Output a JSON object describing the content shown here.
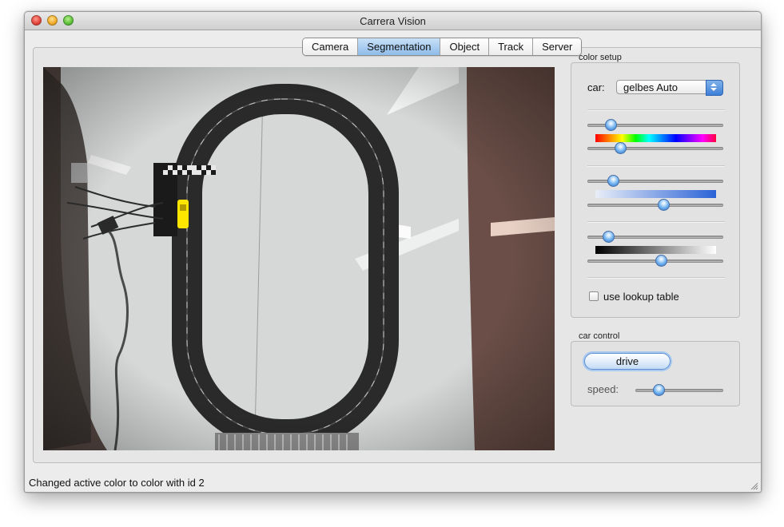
{
  "window": {
    "title": "Carrera Vision"
  },
  "tabs": [
    {
      "label": "Camera",
      "active": false
    },
    {
      "label": "Segmentation",
      "active": true
    },
    {
      "label": "Object",
      "active": false
    },
    {
      "label": "Track",
      "active": false
    },
    {
      "label": "Server",
      "active": false
    }
  ],
  "color_setup": {
    "group_label": "color setup",
    "car_label": "car:",
    "car_select_value": "gelbes Auto",
    "hue": {
      "lower": 0.17,
      "upper": 0.24
    },
    "saturation": {
      "lower": 0.19,
      "upper": 0.56
    },
    "value": {
      "lower": 0.15,
      "upper": 0.54
    },
    "use_lookup_label": "use lookup table",
    "use_lookup_checked": false
  },
  "car_control": {
    "group_label": "car control",
    "drive_label": "drive",
    "speed_label": "speed:",
    "speed_value": 0.26
  },
  "status_bar": {
    "text": "Changed active color to color with id 2"
  },
  "colors": {
    "accent": "#3d7fd8",
    "active_tab": "#8fbce9",
    "detected_car": "#ffe600"
  },
  "icons": {
    "close": "close-icon",
    "minimize": "minimize-icon",
    "zoom": "zoom-icon",
    "select_arrows": "updown-arrows-icon",
    "resize_grip": "resize-grip-icon"
  }
}
